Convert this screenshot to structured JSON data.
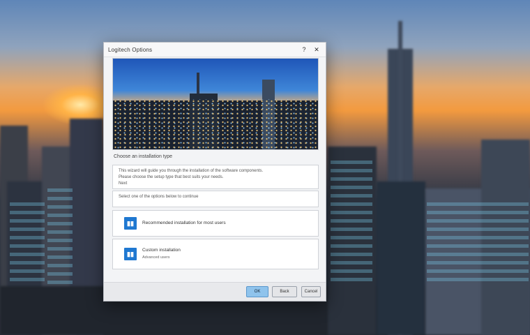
{
  "window": {
    "title": "Logitech Options",
    "help_label": "?",
    "close_label": "✕"
  },
  "section": {
    "label": "Choose an installation type"
  },
  "panels": {
    "info": {
      "line1": "This wizard will guide you through the installation of the software components.",
      "line2": "Please choose the setup type that best suits your needs.",
      "line3": "Next"
    },
    "notice": {
      "line1": "Select one of the options below to continue"
    },
    "option_a": {
      "icon": "▮▮",
      "label": "Recommended installation for most users"
    },
    "option_b": {
      "icon": "▮▮",
      "label": "Custom installation",
      "sub": "Advanced users"
    }
  },
  "footer": {
    "primary_label": "OK",
    "secondary_label": "Back",
    "cancel_label": "Cancel"
  },
  "colors": {
    "accent": "#1f78d1",
    "primary_button": "#8fc3ec"
  }
}
